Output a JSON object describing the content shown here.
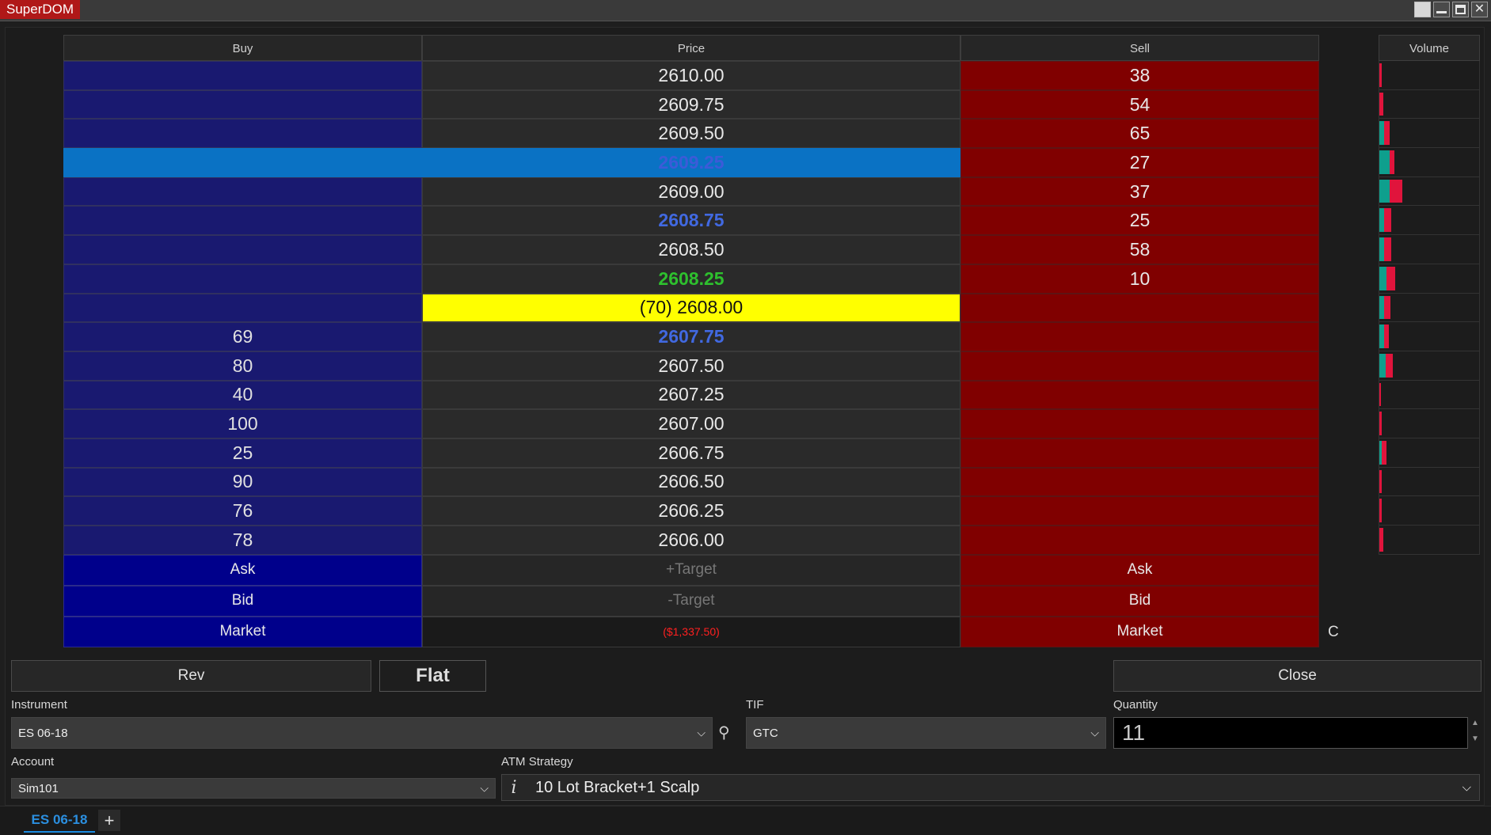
{
  "window": {
    "title": "SuperDOM"
  },
  "ladder": {
    "headers": {
      "buy": "Buy",
      "price": "Price",
      "sell": "Sell"
    },
    "rows": [
      {
        "buy": "",
        "price": "2610.00",
        "sell": "38"
      },
      {
        "buy": "",
        "price": "2609.75",
        "sell": "54"
      },
      {
        "buy": "",
        "price": "2609.50",
        "sell": "65"
      },
      {
        "buy": "",
        "price": "2609.25",
        "sell": "27"
      },
      {
        "buy": "",
        "price": "2609.00",
        "sell": "37"
      },
      {
        "buy": "",
        "price": "2608.75",
        "sell": "25"
      },
      {
        "buy": "",
        "price": "2608.50",
        "sell": "58"
      },
      {
        "buy": "",
        "price": "2608.25",
        "sell": "10"
      },
      {
        "buy": "",
        "price": "(70) 2608.00",
        "sell": ""
      },
      {
        "buy": "69",
        "price": "2607.75",
        "sell": ""
      },
      {
        "buy": "80",
        "price": "2607.50",
        "sell": ""
      },
      {
        "buy": "40",
        "price": "2607.25",
        "sell": ""
      },
      {
        "buy": "100",
        "price": "2607.00",
        "sell": ""
      },
      {
        "buy": "25",
        "price": "2606.75",
        "sell": ""
      },
      {
        "buy": "90",
        "price": "2606.50",
        "sell": ""
      },
      {
        "buy": "76",
        "price": "2606.25",
        "sell": ""
      },
      {
        "buy": "78",
        "price": "2606.00",
        "sell": ""
      }
    ],
    "actions": {
      "ask_buy": "Ask",
      "target_plus": "+Target",
      "ask_sell": "Ask",
      "bid_buy": "Bid",
      "target_minus": "-Target",
      "bid_sell": "Bid",
      "market_buy": "Market",
      "pnl": "($1,337.50)",
      "market_sell": "Market"
    },
    "c_label": "C"
  },
  "volume": {
    "header": "Volume",
    "bars": [
      {
        "green": 0,
        "red": 3
      },
      {
        "green": 0,
        "red": 5
      },
      {
        "green": 6,
        "red": 7
      },
      {
        "green": 13,
        "red": 6
      },
      {
        "green": 13,
        "red": 16
      },
      {
        "green": 6,
        "red": 9
      },
      {
        "green": 6,
        "red": 9
      },
      {
        "green": 9,
        "red": 11
      },
      {
        "green": 6,
        "red": 8
      },
      {
        "green": 6,
        "red": 6
      },
      {
        "green": 8,
        "red": 9
      },
      {
        "green": 0,
        "red": 2
      },
      {
        "green": 0,
        "red": 3
      },
      {
        "green": 3,
        "red": 6
      },
      {
        "green": 0,
        "red": 3
      },
      {
        "green": 0,
        "red": 3
      },
      {
        "green": 0,
        "red": 5
      }
    ]
  },
  "controls": {
    "rev": "Rev",
    "flat": "Flat",
    "close": "Close",
    "instrument_label": "Instrument",
    "instrument_value": "ES 06-18",
    "tif_label": "TIF",
    "tif_value": "GTC",
    "quantity_label": "Quantity",
    "quantity_value": "11",
    "account_label": "Account",
    "account_value": "Sim101",
    "atm_label": "ATM Strategy",
    "atm_value": "10 Lot Bracket+1 Scalp"
  },
  "tabs": [
    {
      "label": "ES 06-18"
    }
  ],
  "tab_add": "+"
}
